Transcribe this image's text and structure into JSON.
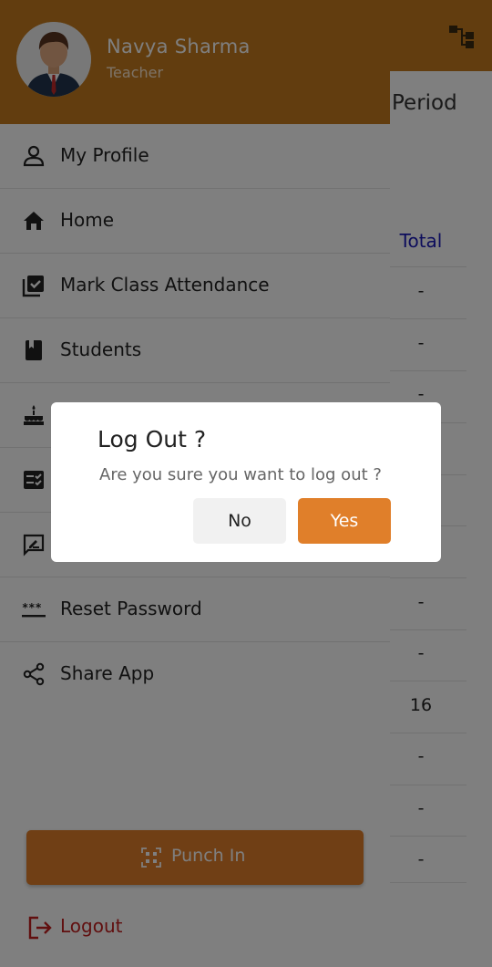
{
  "background_page": {
    "title_fragment": "Period",
    "table_header": "Total",
    "cells": [
      "-",
      "-",
      "-",
      "-",
      "-",
      "-",
      "-",
      "-",
      "16",
      "-",
      "-",
      "-"
    ],
    "header_icon": "hierarchy-icon"
  },
  "drawer": {
    "user": {
      "name": "Navya Sharma",
      "role": "Teacher",
      "avatar_icon": "teacher-avatar"
    },
    "menu": [
      {
        "label": "My Profile",
        "icon": "person-icon"
      },
      {
        "label": "Home",
        "icon": "home-icon"
      },
      {
        "label": "Mark Class Attendance",
        "icon": "attendance-check-icon"
      },
      {
        "label": "Students",
        "icon": "book-icon"
      },
      {
        "label": "",
        "icon": "birthday-cake-icon"
      },
      {
        "label": "",
        "icon": "checklist-icon"
      },
      {
        "label": "",
        "icon": "feedback-icon"
      },
      {
        "label": "Reset Password",
        "icon": "password-icon"
      },
      {
        "label": "Share App",
        "icon": "share-icon"
      }
    ],
    "punch_in": {
      "label": "Punch In",
      "icon": "qr-code-icon"
    },
    "logout": {
      "label": "Logout",
      "icon": "logout-icon"
    }
  },
  "dialog": {
    "title": "Log Out ?",
    "message": "Are you sure you want to log out ?",
    "no_label": "No",
    "yes_label": "Yes"
  },
  "colors": {
    "header": "#c47a1e",
    "accent": "#e07f2a",
    "logout": "#c21f1f",
    "scrim": "rgba(0,0,0,0.5)",
    "table_header_text": "#1a1ab8"
  }
}
